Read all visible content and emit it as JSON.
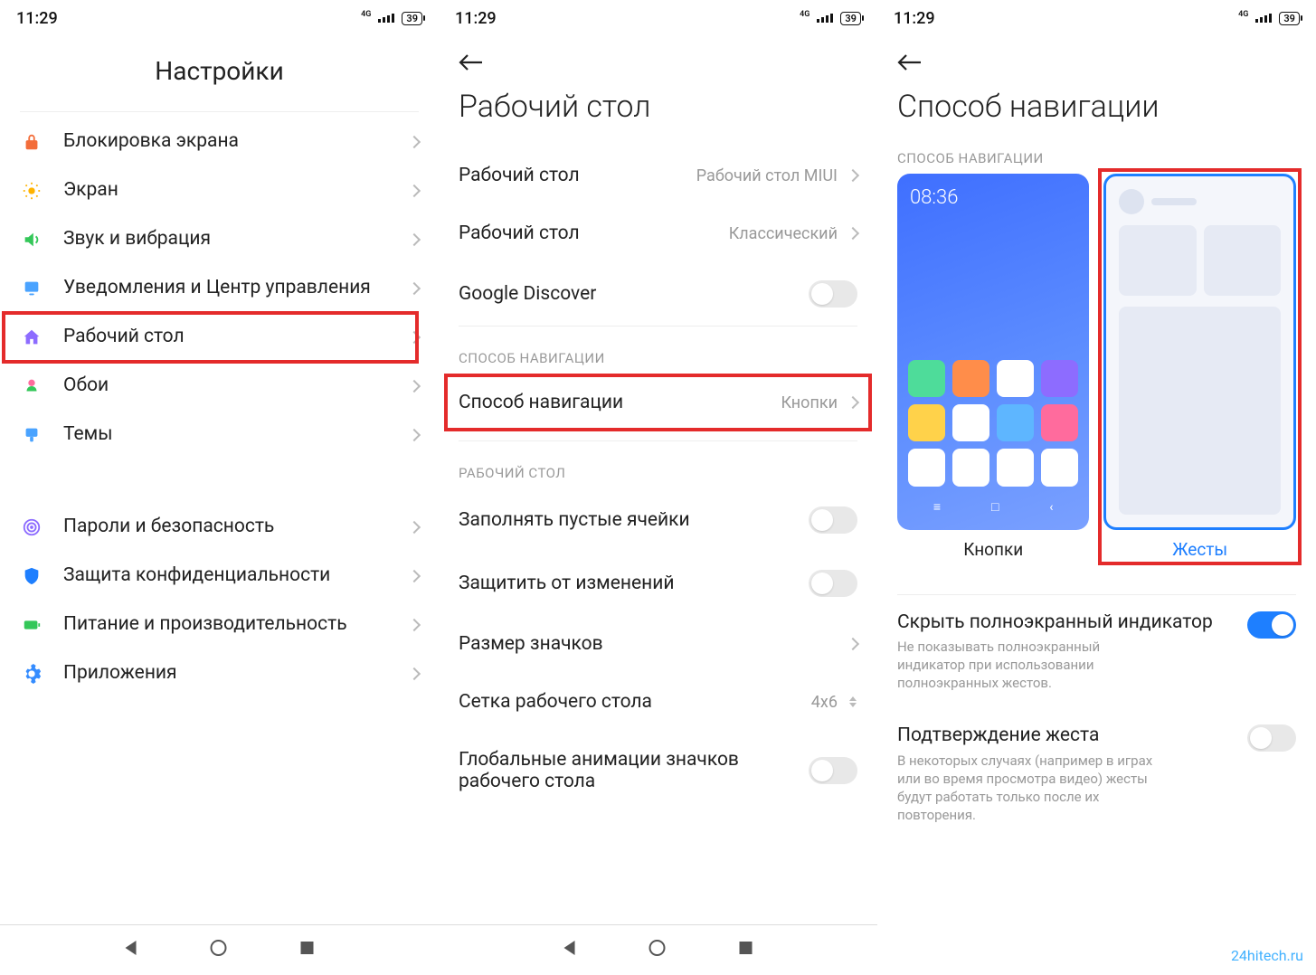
{
  "status": {
    "time": "11:29",
    "net_gen": "4G",
    "battery": "39"
  },
  "screen1": {
    "title": "Настройки",
    "items": [
      {
        "id": "lockscreen",
        "label": "Блокировка экрана",
        "icon": "🔒",
        "color": "#f36d3a"
      },
      {
        "id": "display",
        "label": "Экран",
        "icon": "☀️",
        "color": "#ffb300"
      },
      {
        "id": "sound",
        "label": "Звук и вибрация",
        "icon": "🔊",
        "color": "#34c759"
      },
      {
        "id": "notifications",
        "label": "Уведомления и Центр управления",
        "icon": "🔔",
        "color": "#4aa3ff"
      },
      {
        "id": "home-screen",
        "label": "Рабочий стол",
        "icon": "🏠",
        "color": "#8d6cff",
        "highlighted": true
      },
      {
        "id": "wallpaper",
        "label": "Обои",
        "icon": "🌷",
        "color": "#ff6b9d"
      },
      {
        "id": "themes",
        "label": "Темы",
        "icon": "🎨",
        "color": "#4aa3ff"
      }
    ],
    "items2": [
      {
        "id": "passwords",
        "label": "Пароли и безопасность",
        "icon": "◎",
        "color": "#8d6cff"
      },
      {
        "id": "privacy",
        "label": "Защита конфиденциальности",
        "icon": "🛡️",
        "color": "#1e7fff"
      },
      {
        "id": "battery",
        "label": "Питание и производительность",
        "icon": "🔋",
        "color": "#34c759"
      },
      {
        "id": "apps",
        "label": "Приложения",
        "icon": "⚙️",
        "color": "#1e7fff"
      }
    ]
  },
  "screen2": {
    "title": "Рабочий стол",
    "rows": [
      {
        "id": "launcher",
        "label": "Рабочий стол",
        "value": "Рабочий стол MIUI",
        "type": "link"
      },
      {
        "id": "style",
        "label": "Рабочий стол",
        "value": "Классический",
        "type": "link"
      },
      {
        "id": "discover",
        "label": "Google Discover",
        "type": "toggle",
        "on": false
      }
    ],
    "section_nav": "СПОСОБ НАВИГАЦИИ",
    "nav_row": {
      "id": "nav-method",
      "label": "Способ навигации",
      "value": "Кнопки",
      "highlighted": true
    },
    "section_home": "РАБОЧИЙ СТОЛ",
    "rows2": [
      {
        "id": "fill-empty",
        "label": "Заполнять пустые ячейки",
        "type": "toggle",
        "on": false
      },
      {
        "id": "lock-layout",
        "label": "Защитить от изменений",
        "type": "toggle",
        "on": false
      },
      {
        "id": "icon-size",
        "label": "Размер значков",
        "type": "link"
      },
      {
        "id": "grid",
        "label": "Сетка рабочего стола",
        "value": "4x6",
        "type": "stepper"
      },
      {
        "id": "animations",
        "label": "Глобальные анимации значков рабочего стола",
        "type": "toggle",
        "on": false
      }
    ]
  },
  "screen3": {
    "title": "Способ навигации",
    "section": "СПОСОБ НАВИГАЦИИ",
    "options": {
      "buttons": "Кнопки",
      "gestures": "Жесты",
      "selected": "gestures",
      "highlighted": "gestures",
      "preview_time": "08:36"
    },
    "settings": [
      {
        "id": "hide-indicator",
        "title": "Скрыть полноэкранный индикатор",
        "desc": "Не показывать полноэкранный индикатор при использовании полноэкранных жестов.",
        "on": true
      },
      {
        "id": "confirm-gesture",
        "title": "Подтверждение жеста",
        "desc": "В некоторых случаях (например в играх или во время просмотра видео) жесты будут работать только после их повторения.",
        "on": false
      }
    ]
  },
  "watermark": "24hitech.ru"
}
